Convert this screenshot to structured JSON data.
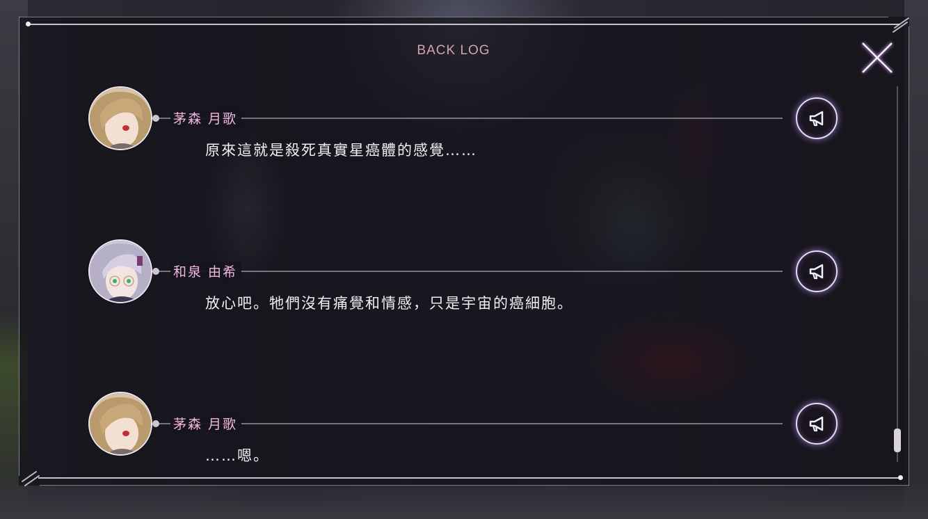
{
  "title": "BACK LOG",
  "entries": [
    {
      "speaker": "茅森 月歌",
      "line": "原來這就是殺死真實星癌體的感覺……",
      "avatar": "tsukuta-portrait",
      "voice_icon": "megaphone-icon"
    },
    {
      "speaker": "和泉 由希",
      "line": "放心吧。牠們沒有痛覺和情感，只是宇宙的癌細胞。",
      "avatar": "yuki-portrait",
      "voice_icon": "megaphone-icon"
    },
    {
      "speaker": "茅森 月歌",
      "line": "……嗯。",
      "avatar": "tsukuta-portrait",
      "voice_icon": "megaphone-icon"
    }
  ],
  "colors": {
    "name": "#f3b6e0",
    "title": "#d6a3ad",
    "text": "#f2eff3",
    "glow": "#be96ff"
  },
  "close_icon": "close-icon"
}
